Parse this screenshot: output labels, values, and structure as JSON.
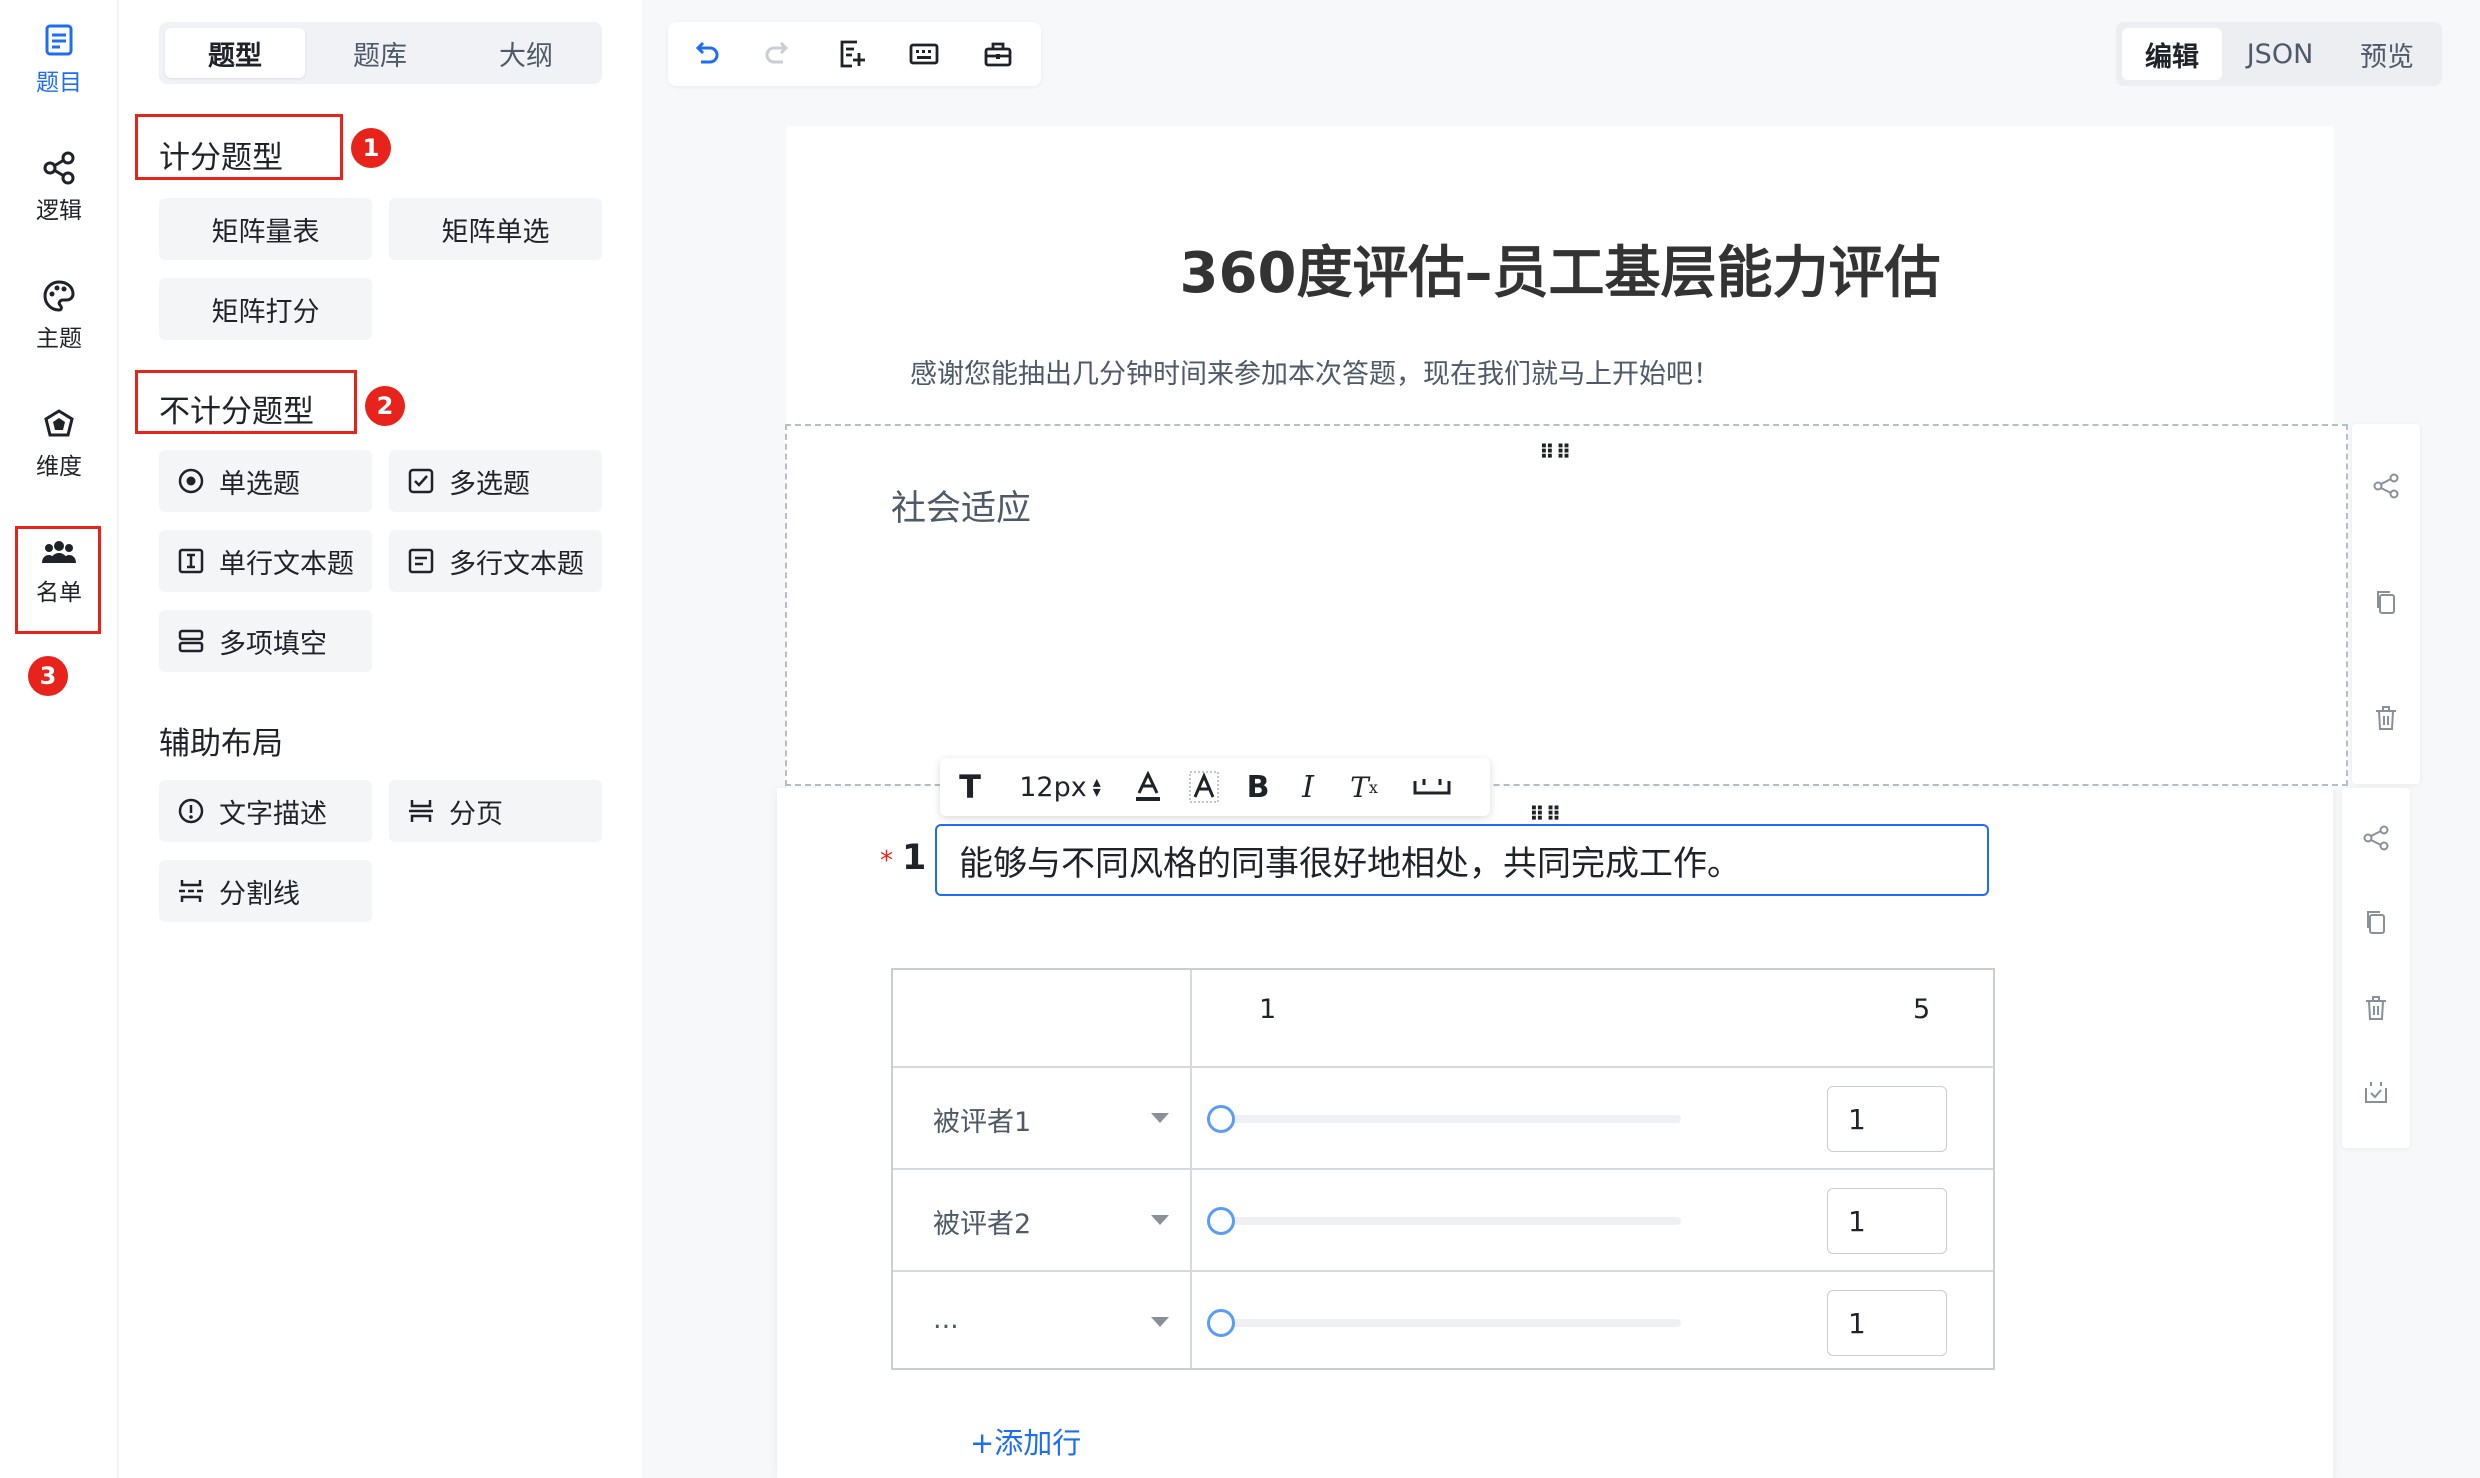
{
  "rail": {
    "items": [
      {
        "label": "题目",
        "icon": "question-icon",
        "active": true
      },
      {
        "label": "逻辑",
        "icon": "logic-icon"
      },
      {
        "label": "主题",
        "icon": "palette-icon"
      },
      {
        "label": "维度",
        "icon": "dimension-icon"
      },
      {
        "label": "名单",
        "icon": "people-icon"
      }
    ],
    "badge3": "3"
  },
  "panel": {
    "tabs": [
      "题型",
      "题库",
      "大纲"
    ],
    "scored": {
      "title": "计分题型",
      "badge": "1",
      "items": [
        "矩阵量表",
        "矩阵单选",
        "矩阵打分"
      ]
    },
    "unscored": {
      "title": "不计分题型",
      "badge": "2",
      "items": [
        {
          "label": "单选题",
          "icon": "radio-icon"
        },
        {
          "label": "多选题",
          "icon": "checkbox-icon"
        },
        {
          "label": "单行文本题",
          "icon": "text-input-icon"
        },
        {
          "label": "多行文本题",
          "icon": "textarea-icon"
        },
        {
          "label": "多项填空",
          "icon": "multi-fill-icon"
        }
      ]
    },
    "layout": {
      "title": "辅助布局",
      "items": [
        {
          "label": "文字描述",
          "icon": "info-icon"
        },
        {
          "label": "分页",
          "icon": "page-break-icon"
        },
        {
          "label": "分割线",
          "icon": "divider-icon"
        }
      ]
    }
  },
  "toolbar": {
    "icons": [
      "undo-icon",
      "redo-icon",
      "import-icon",
      "keyboard-icon",
      "toolbox-icon"
    ]
  },
  "modes": [
    "编辑",
    "JSON",
    "预览"
  ],
  "survey": {
    "title": "360度评估–员工基层能力评估",
    "description": "感谢您能抽出几分钟时间来参加本次答题，现在我们就马上开始吧！",
    "section_title": "社会适应",
    "question": {
      "number": "1",
      "required_mark": "*",
      "text": "能够与不同风格的同事很好地相处，共同完成工作。",
      "rich_toolbar": {
        "font_size": "12px"
      },
      "scale_min": "1",
      "scale_max": "5",
      "rows": [
        {
          "label": "被评者1",
          "value": "1"
        },
        {
          "label": "被评者2",
          "value": "1"
        },
        {
          "label": "...",
          "value": "1"
        }
      ],
      "add_row": "+添加行"
    }
  },
  "colors": {
    "accent": "#1d6df5",
    "annotation": "#e8231b"
  }
}
